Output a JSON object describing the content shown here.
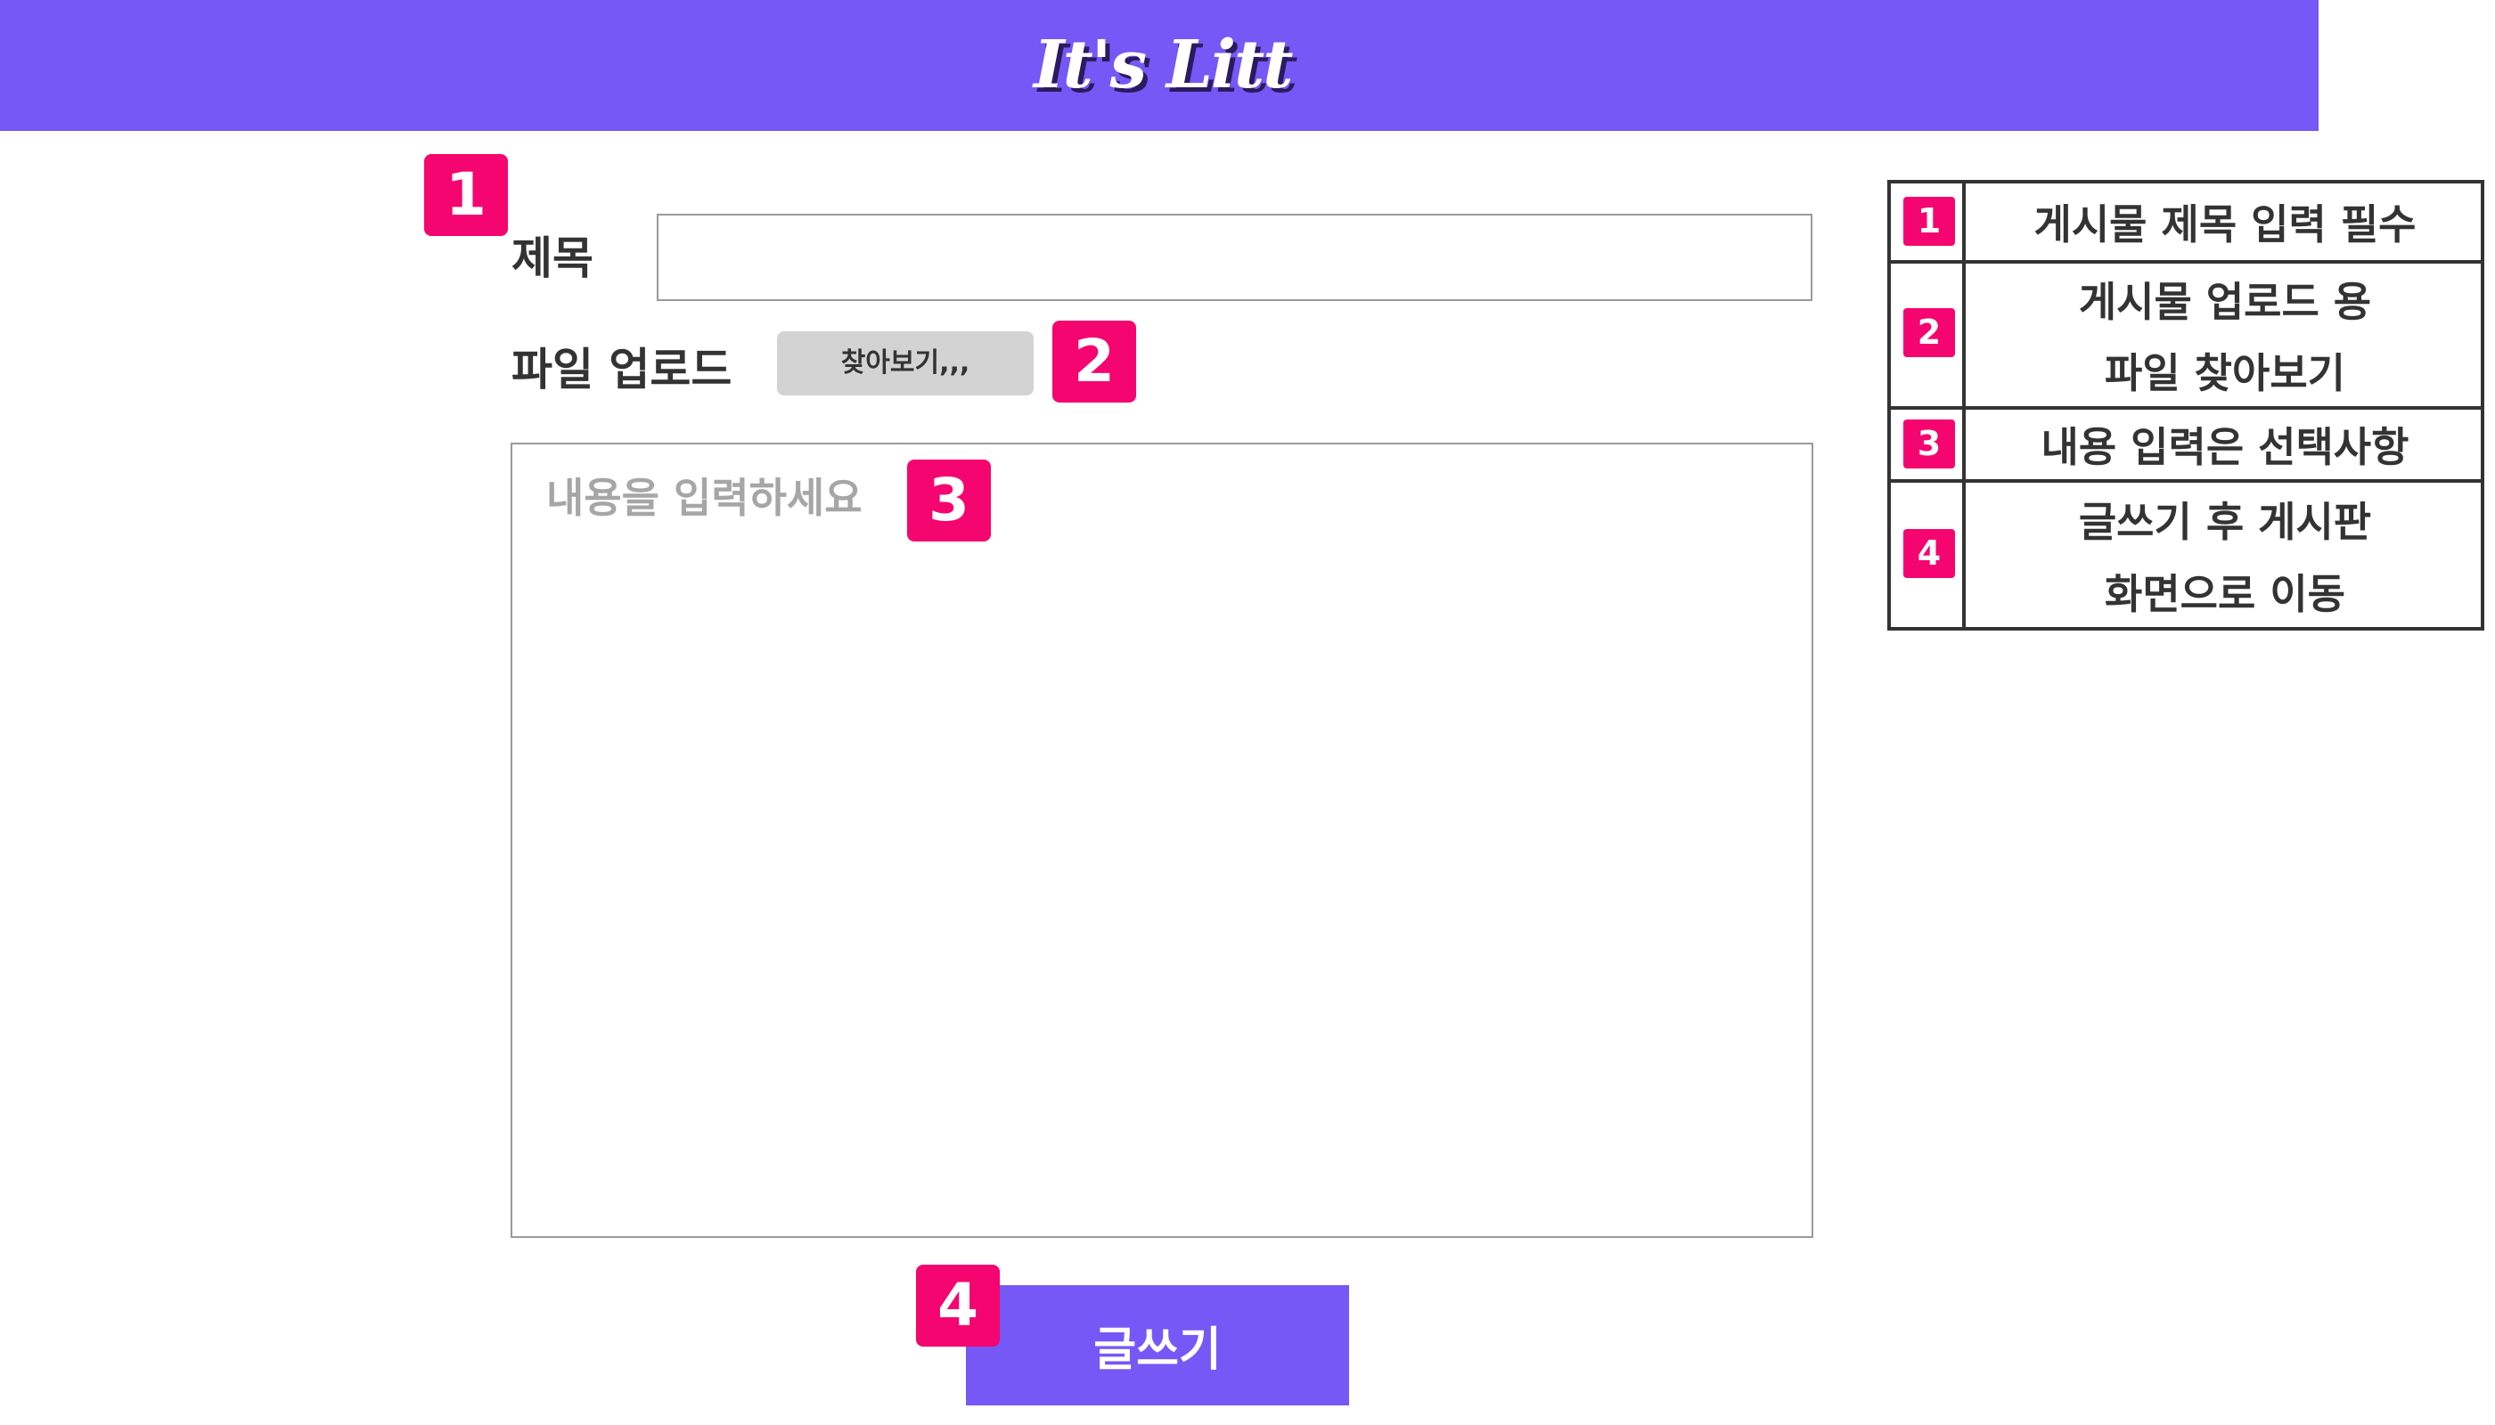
{
  "header": {
    "logo_text": "It's Litt",
    "background_color": "#7558f5"
  },
  "form": {
    "title_label": "제목",
    "title_value": "",
    "file_upload_label": "파일 업로드",
    "browse_button_label": "찾아보기,,,",
    "content_placeholder": "내용을 입력하세요",
    "content_value": "",
    "submit_button_label": "글쓰기"
  },
  "annotations": {
    "badges": [
      "1",
      "2",
      "3",
      "4"
    ],
    "badge_color": "#f5056f"
  },
  "legend": {
    "rows": [
      {
        "num": "1",
        "lines": [
          "게시물 제목 입력 필수"
        ]
      },
      {
        "num": "2",
        "lines": [
          "게시물 업로드 용",
          "파일 찾아보기"
        ]
      },
      {
        "num": "3",
        "lines": [
          "내용 입력은 선택사항"
        ]
      },
      {
        "num": "4",
        "lines": [
          "글쓰기 후 게시판",
          "화면으로 이동"
        ]
      }
    ]
  }
}
